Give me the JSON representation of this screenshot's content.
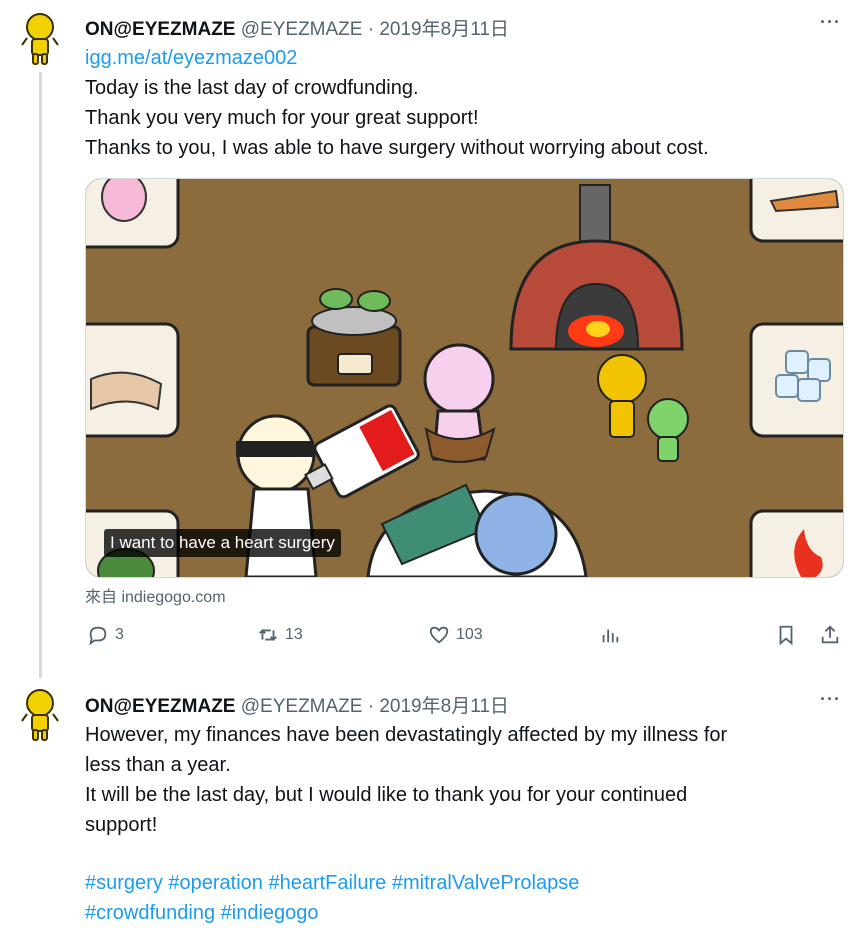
{
  "tweets": [
    {
      "name": "ON@EYEZMAZE",
      "handle": "@EYEZMAZE",
      "separator": "·",
      "date": "2019年8月11日",
      "more": "···",
      "link": "igg.me/at/eyezmaze002",
      "lines": [
        "Today is the last day of crowdfunding.",
        "Thank you very much for your great support!",
        "Thanks to you, I was able to have surgery without worrying about cost."
      ],
      "media": {
        "subtitle": "I want to have a heart surgery"
      },
      "source": "來自 indiegogo.com",
      "stats": {
        "replies": "3",
        "retweets": "13",
        "likes": "103"
      }
    },
    {
      "name": "ON@EYEZMAZE",
      "handle": "@EYEZMAZE",
      "separator": "·",
      "date": "2019年8月11日",
      "more": "···",
      "lines": [
        "However, my finances have been devastatingly affected by my illness for",
        "less than a year.",
        "It will be the last day, but I would like to thank you for your continued",
        "support!"
      ],
      "hashtag_lines": [
        "#surgery #operation #heartFailure #mitralValveProlapse",
        "#crowdfunding #indiegogo"
      ]
    }
  ],
  "colors": {
    "link": "#1d9bf0",
    "muted": "#536471",
    "text": "#0f1419",
    "avatar": "#f2d100"
  },
  "icons": [
    "reply-icon",
    "retweet-icon",
    "like-icon",
    "views-icon",
    "bookmark-icon",
    "share-icon",
    "more-icon"
  ]
}
